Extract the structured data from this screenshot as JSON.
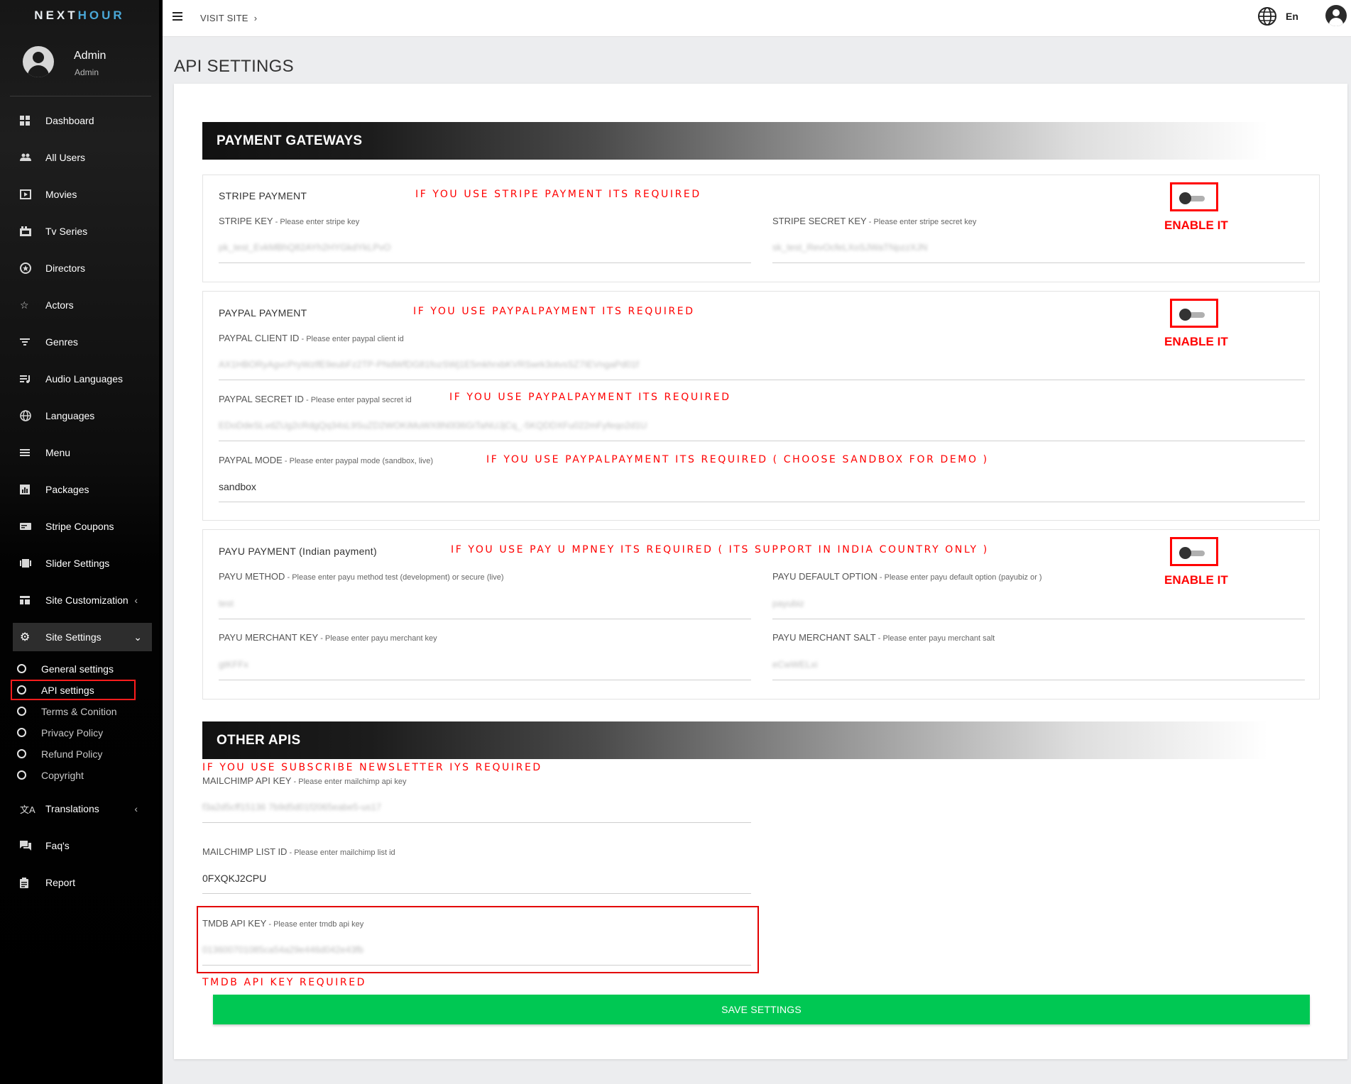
{
  "brand": {
    "logo_pre": "NEXT",
    "logo_post": "HOUR",
    "logo_accent_color": "#4aa8d8"
  },
  "user": {
    "name": "Admin",
    "role": "Admin"
  },
  "sidebar": {
    "items": [
      {
        "label": "Dashboard",
        "icon": "dashboard-icon"
      },
      {
        "label": "All Users",
        "icon": "users-icon"
      },
      {
        "label": "Movies",
        "icon": "movie-icon"
      },
      {
        "label": "Tv Series",
        "icon": "tv-icon"
      },
      {
        "label": "Directors",
        "icon": "director-icon"
      },
      {
        "label": "Actors",
        "icon": "star-icon"
      },
      {
        "label": "Genres",
        "icon": "filter-icon"
      },
      {
        "label": "Audio Languages",
        "icon": "audio-list-icon"
      },
      {
        "label": "Languages",
        "icon": "globe-icon"
      },
      {
        "label": "Menu",
        "icon": "menu-icon"
      },
      {
        "label": "Packages",
        "icon": "packages-icon"
      },
      {
        "label": "Stripe Coupons",
        "icon": "coupon-icon"
      },
      {
        "label": "Slider Settings",
        "icon": "slider-icon"
      },
      {
        "label": "Site Customization",
        "icon": "customize-icon"
      },
      {
        "label": "Site Settings",
        "icon": "gear-icon"
      },
      {
        "label": "Translations",
        "icon": "translate-icon"
      },
      {
        "label": "Faq's",
        "icon": "faq-icon"
      },
      {
        "label": "Report",
        "icon": "report-icon"
      }
    ],
    "sub_items": [
      {
        "label": "General settings"
      },
      {
        "label": "API settings"
      },
      {
        "label": "Terms & Conition"
      },
      {
        "label": "Privacy Policy"
      },
      {
        "label": "Refund Policy"
      },
      {
        "label": "Copyright"
      }
    ]
  },
  "topbar": {
    "visit_site": "VISIT SITE",
    "language": "En"
  },
  "page": {
    "title": "API SETTINGS"
  },
  "payment_gateways": {
    "title": "PAYMENT GATEWAYS",
    "stripe": {
      "title": "STRIPE PAYMENT",
      "warning": "IF YOU USE STRIPE PAYMENT ITS REQUIRED",
      "enable_label": "ENABLE IT",
      "key_label": "STRIPE KEY",
      "key_hint": " - Please enter stripe key",
      "key_value": "pk_test_EvkMBhQ82AYh2HYGkdYkLPvO",
      "secret_label": "STRIPE SECRET KEY",
      "secret_hint": " - Please enter stripe secret key",
      "secret_value": "sk_test_RevOcfeLXoSJWaTNpzzXJN"
    },
    "paypal": {
      "title": "PAYPAL PAYMENT",
      "warning": "IF YOU USE PAYPALPAYMENT ITS REQUIRED",
      "enable_label": "ENABLE IT",
      "client_label": "PAYPAL CLIENT ID",
      "client_hint": " - Please enter paypal client id",
      "client_value": "AX1HBORyAgvcPryWzlfE9eubFz2TP-PNdWfDG81fozSWj1E5mkhrxbKVRSwrk3otvsSZ7IEVngaPd01f",
      "secret_label": "PAYPAL SECRET ID",
      "secret_hint": " - Please enter paypal secret id",
      "secret_warning": "IF YOU USE PAYPALPAYMENT ITS REQUIRED",
      "secret_value": "EDoDdeSLvdZUg2cRdgQq34sL9SuZD2WOKiMuWX8N0l36GiTaNUJjCq_-5KQDDXFu022mFyfeqo2d1U",
      "mode_label": "PAYPAL MODE",
      "mode_hint": " - Please enter paypal mode (sandbox, live)",
      "mode_warning": "IF YOU USE PAYPALPAYMENT ITS REQUIRED ( CHOOSE SANDBOX FOR DEMO )",
      "mode_value": "sandbox"
    },
    "payu": {
      "title": "PAYU PAYMENT (Indian payment)",
      "warning": "IF YOU USE PAY U MPNEY ITS REQUIRED ( ITS SUPPORT IN INDIA COUNTRY ONLY )",
      "enable_label": "ENABLE IT",
      "method_label": "PAYU METHOD",
      "method_hint": " - Please enter payu method test (development) or secure (live)",
      "method_value": "test",
      "default_label": "PAYU DEFAULT OPTION",
      "default_hint": " - Please enter payu default option (payubiz or )",
      "default_value": "payubiz",
      "merchant_key_label": "PAYU MERCHANT KEY",
      "merchant_key_hint": " - Please enter payu merchant key",
      "merchant_key_value": "gtKFFx",
      "salt_label": "PAYU MERCHANT SALT",
      "salt_hint": " - Please enter payu merchant salt",
      "salt_value": "eCwWELxi"
    }
  },
  "other_apis": {
    "title": "OTHER APIS",
    "newsletter_warning": "IF YOU USE SUBSCRIBE NEWSLETTER IYS REQUIRED",
    "mailchimp_key_label": "MAILCHIMP API KEY",
    "mailchimp_key_hint": " - Please enter mailchimp api key",
    "mailchimp_key_value": "f3a2d5cff15136 7b9d5d01f2065eabe5-us17",
    "mailchimp_list_label": "MAILCHIMP LIST ID",
    "mailchimp_list_hint": " - Please enter mailchimp list id",
    "mailchimp_list_value": "0FXQKJ2CPU",
    "tmdb_label": "TMDB API KEY",
    "tmdb_hint": " - Please enter tmdb api key",
    "tmdb_value": "013600701085ca54a29e446d042e43fb",
    "tmdb_warning": "TMDB API KEY REQUIRED"
  },
  "save_button": "SAVE SETTINGS",
  "colors": {
    "warning": "#ff0000",
    "save": "#00c853",
    "sidebar": "#111111"
  }
}
